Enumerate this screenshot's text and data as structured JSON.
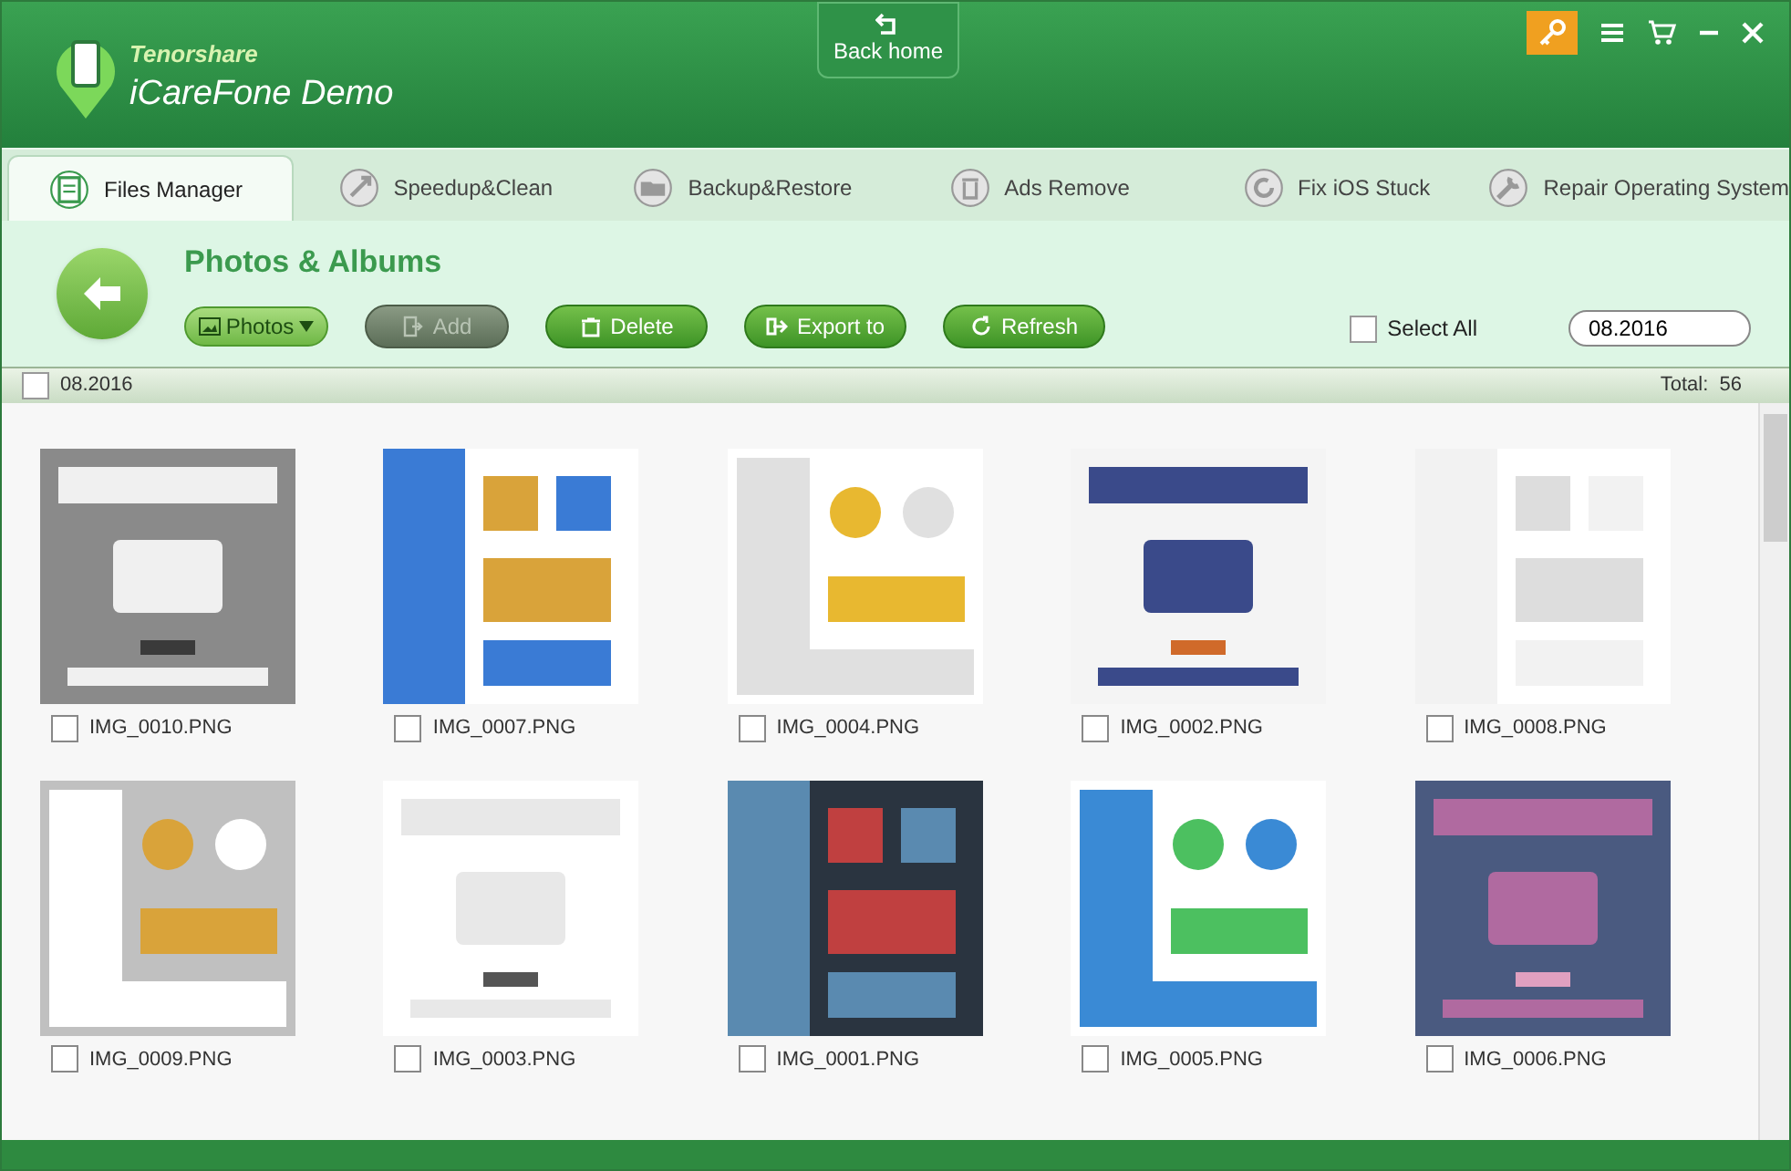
{
  "app": {
    "brand": "Tenorshare",
    "title": "iCareFone Demo"
  },
  "back_home": "Back home",
  "tabs": [
    {
      "label": "Files Manager",
      "selected": true
    },
    {
      "label": "Speedup&Clean",
      "selected": false
    },
    {
      "label": "Backup&Restore",
      "selected": false
    },
    {
      "label": "Ads Remove",
      "selected": false
    },
    {
      "label": "Fix iOS Stuck",
      "selected": false
    },
    {
      "label": "Repair Operating System",
      "selected": false
    }
  ],
  "section_title": "Photos & Albums",
  "view_dropdown": "Photos",
  "actions": [
    {
      "label": "Add",
      "disabled": true
    },
    {
      "label": "Delete",
      "disabled": false
    },
    {
      "label": "Export to",
      "disabled": false
    },
    {
      "label": "Refresh",
      "disabled": false
    }
  ],
  "select_all": {
    "label": "Select All",
    "checked": false
  },
  "date_field": "08.2016",
  "group": {
    "label": "08.2016",
    "checked": false,
    "total": "Total:  56"
  },
  "photos": [
    {
      "name": "IMG_0010.PNG",
      "checked": false
    },
    {
      "name": "IMG_0007.PNG",
      "checked": false
    },
    {
      "name": "IMG_0004.PNG",
      "checked": false
    },
    {
      "name": "IMG_0002.PNG",
      "checked": false
    },
    {
      "name": "IMG_0008.PNG",
      "checked": false
    },
    {
      "name": "IMG_0009.PNG",
      "checked": false
    },
    {
      "name": "IMG_0003.PNG",
      "checked": false
    },
    {
      "name": "IMG_0001.PNG",
      "checked": false
    },
    {
      "name": "IMG_0005.PNG",
      "checked": false
    },
    {
      "name": "IMG_0006.PNG",
      "checked": false
    }
  ]
}
